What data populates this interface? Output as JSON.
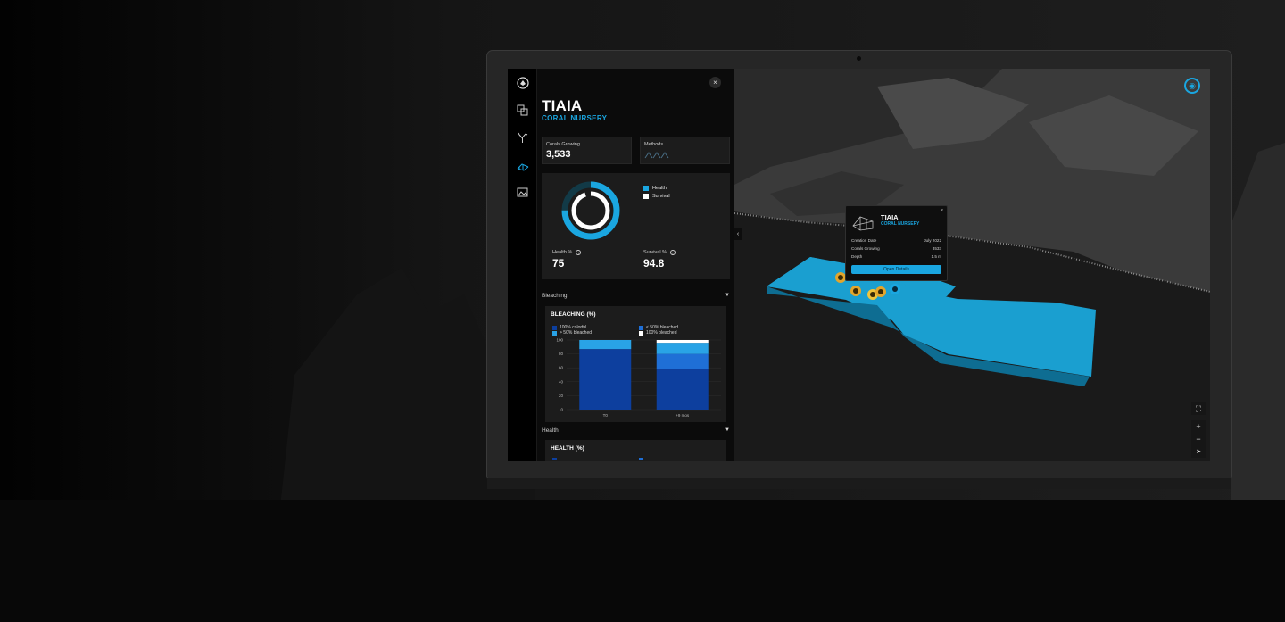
{
  "panel": {
    "title": "TIAIA",
    "subtitle": "CORAL NURSERY",
    "close_label": "×",
    "stats": {
      "corals_label": "Corals Growing",
      "corals_value": "3,533",
      "methods_label": "Methods"
    },
    "donut": {
      "legend": [
        {
          "label": "Health",
          "color": "#1aa6e0"
        },
        {
          "label": "Survival",
          "color": "#ffffff"
        }
      ],
      "health_label": "Health %",
      "health_value": "75",
      "survival_label": "Survival %",
      "survival_value": "94.8"
    },
    "sections": {
      "bleaching": "Bleaching",
      "health": "Health"
    }
  },
  "bleaching_chart": {
    "title": "BLEACHING (%)",
    "legend": [
      {
        "label": "100% colorful",
        "color": "#0d3f9e"
      },
      {
        "label": "< 50% bleached",
        "color": "#1f6fd6"
      },
      {
        "label": "> 50% bleached",
        "color": "#29a3e6"
      },
      {
        "label": "100% bleached",
        "color": "#ffffff"
      }
    ]
  },
  "health_chart": {
    "title": "HEALTH (%)"
  },
  "popup": {
    "title": "TIAIA",
    "subtitle": "CORAL NURSERY",
    "close_label": "×",
    "rows": [
      {
        "label": "Creation Date",
        "value": "July 2022"
      },
      {
        "label": "Corals Growing",
        "value": "3533"
      },
      {
        "label": "Depth",
        "value": "1.5 m"
      }
    ],
    "button_label": "Open Details"
  },
  "map_controls": {
    "fullscreen": "⛶",
    "zoom_in": "+",
    "zoom_out": "−",
    "compass": "➤"
  },
  "colors": {
    "accent": "#1aa6e0",
    "nursery_top": "#1a9fd0",
    "nursery_side": "#0e6d92",
    "marker": "#e3a52b"
  },
  "chart_data": {
    "type": "bar",
    "title": "BLEACHING (%)",
    "categories": [
      "T0",
      "+9 mos"
    ],
    "series": [
      {
        "name": "100% colorful",
        "values": [
          87,
          58
        ]
      },
      {
        "name": "< 50% bleached",
        "values": [
          0,
          22
        ]
      },
      {
        "name": "> 50% bleached",
        "values": [
          13,
          16
        ]
      },
      {
        "name": "100% bleached",
        "values": [
          0,
          4
        ]
      }
    ],
    "stacked": true,
    "y_ticks": [
      0,
      20,
      40,
      60,
      80,
      100
    ],
    "ylim": [
      0,
      100
    ],
    "grid": true
  }
}
